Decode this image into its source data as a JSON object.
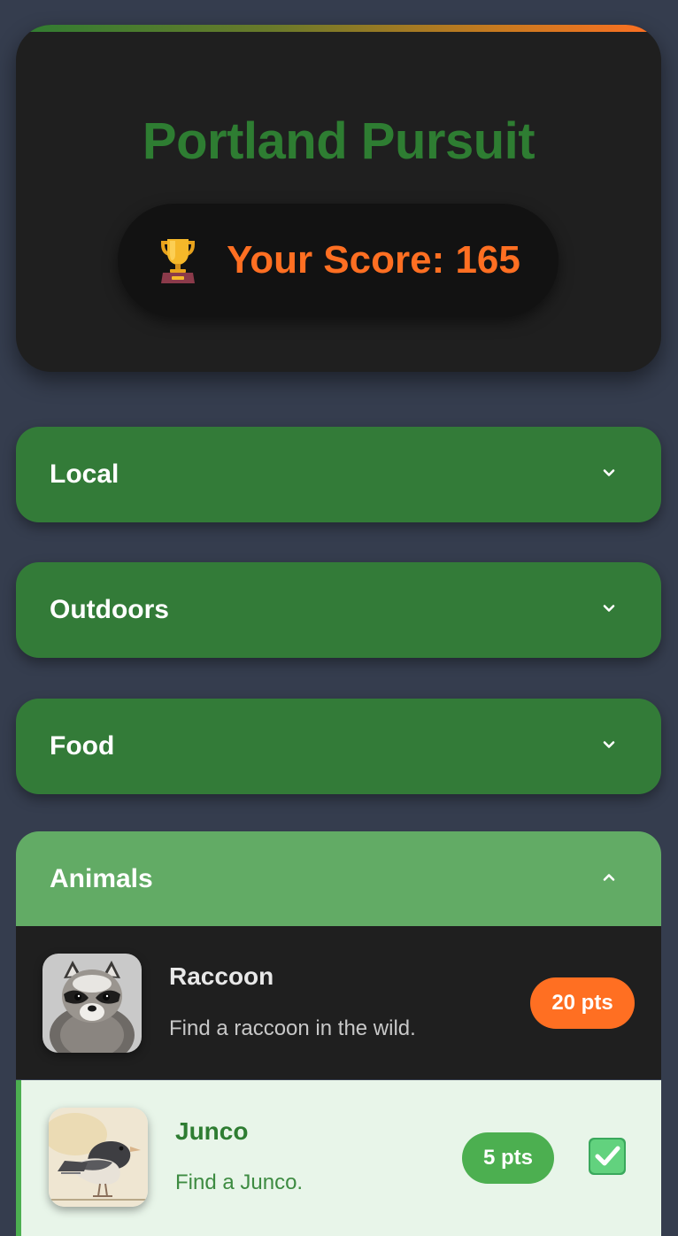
{
  "header": {
    "title": "Portland Pursuit",
    "score_label": "Your Score: 165",
    "score": 165,
    "trophy_icon": "trophy-icon"
  },
  "categories": [
    {
      "label": "Local",
      "expanded": false,
      "icon": "chevron-down-icon"
    },
    {
      "label": "Outdoors",
      "expanded": false,
      "icon": "chevron-down-icon"
    },
    {
      "label": "Food",
      "expanded": false,
      "icon": "chevron-down-icon"
    },
    {
      "label": "Animals",
      "expanded": true,
      "icon": "chevron-up-icon"
    }
  ],
  "animals": {
    "items": [
      {
        "name": "Raccoon",
        "description": "Find a raccoon in the wild.",
        "points": "20 pts",
        "completed": false,
        "image_icon": "raccoon-image"
      },
      {
        "name": "Junco",
        "description": "Find a Junco.",
        "points": "5 pts",
        "completed": true,
        "image_icon": "junco-image",
        "check_icon": "checkmark-icon"
      }
    ]
  },
  "colors": {
    "background": "#353d4e",
    "card": "#1f1f1f",
    "brand_green": "#2e7d32",
    "category_green": "#337b38",
    "category_open": "#62ab65",
    "accent_orange": "#ff6f22",
    "done_bg": "#e8f5e9",
    "done_badge": "#4caf50"
  }
}
